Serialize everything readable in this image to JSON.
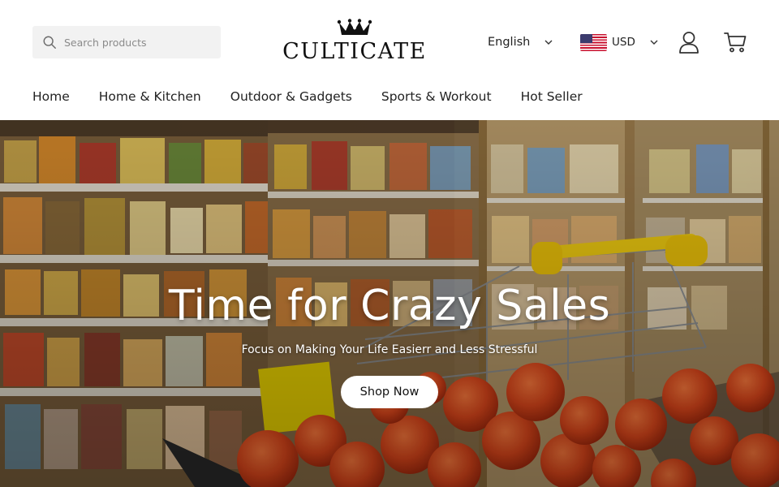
{
  "search": {
    "placeholder": "Search products"
  },
  "logo": {
    "text": "CULTICATE"
  },
  "language": {
    "selected": "English"
  },
  "currency": {
    "selected": "USD",
    "flag": "us-flag-icon"
  },
  "icons": {
    "account": "user-icon",
    "cart": "cart-icon",
    "search": "search-icon"
  },
  "nav": {
    "items": [
      {
        "label": "Home"
      },
      {
        "label": "Home & Kitchen"
      },
      {
        "label": "Outdoor & Gadgets"
      },
      {
        "label": "Sports & Workout"
      },
      {
        "label": "Hot Seller"
      }
    ]
  },
  "hero": {
    "title": "Time for Crazy Sales",
    "subtitle": "Focus on Making Your Life Easierr and Less Stressful",
    "cta": "Shop Now"
  },
  "colors": {
    "accent_yellow": "#e8c200",
    "tomato": "#d8451a",
    "text": "#222222"
  }
}
